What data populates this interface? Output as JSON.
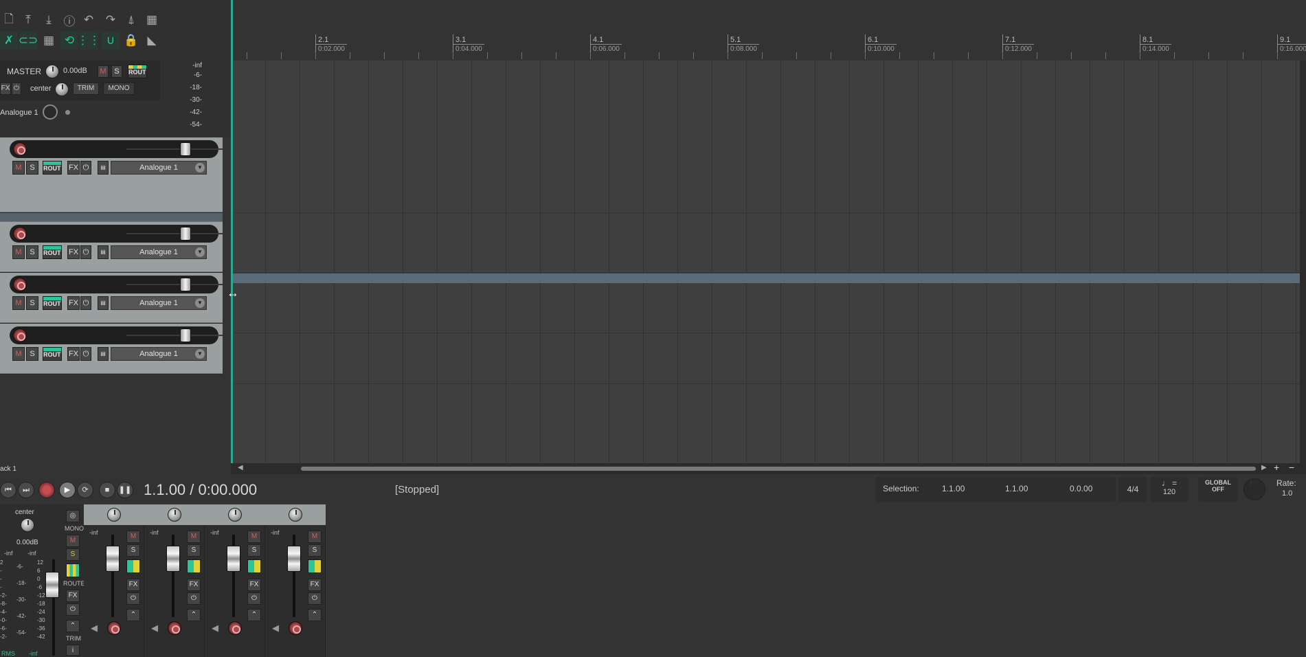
{
  "master": {
    "name": "MASTER",
    "volume": "0.00dB",
    "pan": "center",
    "fx": "FX",
    "route": "ROUTE",
    "trim": "TRIM",
    "mono": "MONO",
    "mute": "M",
    "solo": "S",
    "input": "Analogue 1",
    "meter_scale": [
      "-inf",
      "-6-",
      "-18-",
      "-30-",
      "-42-",
      "-54-"
    ]
  },
  "tracks": [
    {
      "mute": "M",
      "solo": "S",
      "route": "ROUTE",
      "fx": "FX",
      "input": "Analogue 1"
    },
    {
      "mute": "M",
      "solo": "S",
      "route": "ROUTE",
      "fx": "FX",
      "input": "Analogue 1"
    },
    {
      "mute": "M",
      "solo": "S",
      "route": "ROUTE",
      "fx": "FX",
      "input": "Analogue 1"
    },
    {
      "mute": "M",
      "solo": "S",
      "route": "ROUTE",
      "fx": "FX",
      "input": "Analogue 1"
    }
  ],
  "ruler": [
    {
      "bar": "2.1",
      "time": "0:02.000"
    },
    {
      "bar": "3.1",
      "time": "0:04.000"
    },
    {
      "bar": "4.1",
      "time": "0:06.000"
    },
    {
      "bar": "5.1",
      "time": "0:08.000"
    },
    {
      "bar": "6.1",
      "time": "0:10.000"
    },
    {
      "bar": "7.1",
      "time": "0:12.000"
    },
    {
      "bar": "8.1",
      "time": "0:14.000"
    },
    {
      "bar": "9.1",
      "time": "0:16.000"
    }
  ],
  "tcp_footer": "ack 1",
  "transport": {
    "position": "1.1.00 / 0:00.000",
    "status": "[Stopped]",
    "selection_label": "Selection:",
    "sel_start": "1.1.00",
    "sel_end": "1.1.00",
    "sel_length": "0.0.00",
    "time_sig": "4/4",
    "bpm": "120",
    "bpm_symbol": "♩ =",
    "global_label": "GLOBAL",
    "global_state": "OFF",
    "rate_label": "Rate:",
    "rate_value": "1.0"
  },
  "mixer": {
    "pan": "center",
    "volume": "0.00dB",
    "meter_left": "-inf",
    "meter_right": "-inf",
    "rms": "RMS",
    "rms_value": "-inf",
    "mono": "MONO",
    "route": "ROUTE",
    "trim": "TRIM",
    "fx": "FX",
    "mute": "M",
    "solo": "S",
    "strip_level": "-inf",
    "scale_left": [
      "2",
      "-",
      "-",
      "-",
      "-2-",
      "-8-",
      "-4-",
      "-0-",
      "-6-",
      "-2-"
    ],
    "scale_mid": [
      "-6-",
      "-18-",
      "-30-",
      "-42-",
      "-54-"
    ],
    "scale_right": [
      "12",
      "6",
      "0",
      "-6",
      "-12",
      "-18",
      "-24",
      "-30",
      "-36",
      "-42"
    ]
  },
  "colors": {
    "accent": "#2aa991",
    "track_bg": "#9aa09f",
    "record": "#c74d52"
  }
}
